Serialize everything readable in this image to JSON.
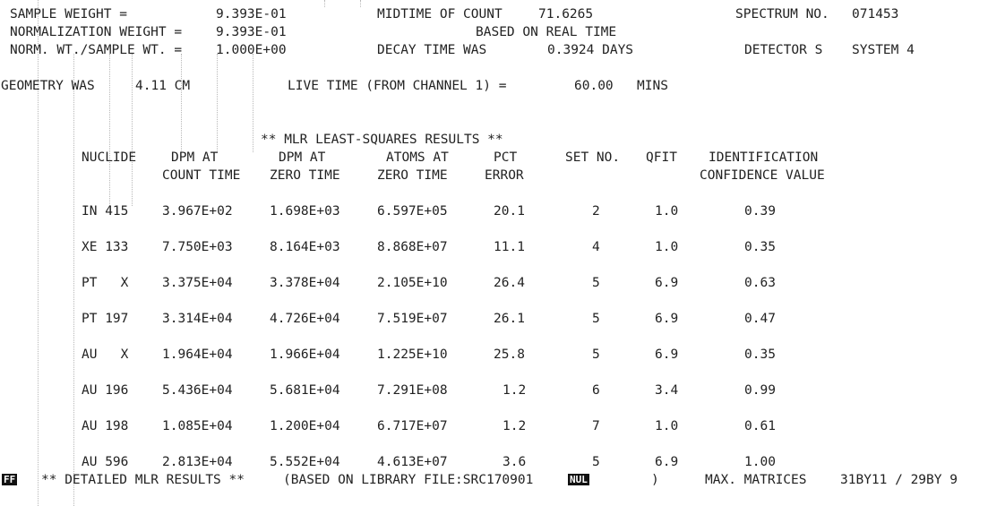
{
  "header": {
    "sample_weight_label": "SAMPLE WEIGHT =",
    "sample_weight_value": "9.393E-01",
    "norm_weight_label": "NORMALIZATION WEIGHT =",
    "norm_weight_value": "9.393E-01",
    "ratio_label": "NORM. WT./SAMPLE WT. =",
    "ratio_value": "1.000E+00",
    "midtime_label": "MIDTIME OF COUNT",
    "midtime_value": "71.6265",
    "based_on": "BASED ON REAL TIME",
    "decay_label": "DECAY TIME WAS",
    "decay_value": "0.3924 DAYS",
    "spectrum_label": "SPECTRUM NO.",
    "spectrum_value": "071453",
    "detector": "DETECTOR S",
    "system": "SYSTEM 4",
    "geometry_label": "GEOMETRY WAS",
    "geometry_value": "4.11 CM",
    "live_time_label": "LIVE TIME (FROM CHANNEL 1) =",
    "live_time_value": "60.00",
    "live_time_unit": "MINS"
  },
  "results": {
    "title": "** MLR LEAST-SQUARES RESULTS **",
    "headers": {
      "nuclide": "NUCLIDE",
      "dpm_count_1": "DPM AT",
      "dpm_count_2": "COUNT TIME",
      "dpm_zero_1": "DPM AT",
      "dpm_zero_2": "ZERO TIME",
      "atoms_1": "ATOMS AT",
      "atoms_2": "ZERO TIME",
      "pct_1": "PCT",
      "pct_2": "ERROR",
      "set_no": "SET NO.",
      "qfit": "QFIT",
      "ident_1": "IDENTIFICATION",
      "ident_2": "CONFIDENCE VALUE"
    },
    "rows": [
      {
        "nuclide": "IN 415",
        "dpm_count": "3.967E+02",
        "dpm_zero": "1.698E+03",
        "atoms": "6.597E+05",
        "pct": "20.1",
        "set": "2",
        "qfit": "1.0",
        "conf": "0.39"
      },
      {
        "nuclide": "XE 133",
        "dpm_count": "7.750E+03",
        "dpm_zero": "8.164E+03",
        "atoms": "8.868E+07",
        "pct": "11.1",
        "set": "4",
        "qfit": "1.0",
        "conf": "0.35"
      },
      {
        "nuclide": "PT   X",
        "dpm_count": "3.375E+04",
        "dpm_zero": "3.378E+04",
        "atoms": "2.105E+10",
        "pct": "26.4",
        "set": "5",
        "qfit": "6.9",
        "conf": "0.63"
      },
      {
        "nuclide": "PT 197",
        "dpm_count": "3.314E+04",
        "dpm_zero": "4.726E+04",
        "atoms": "7.519E+07",
        "pct": "26.1",
        "set": "5",
        "qfit": "6.9",
        "conf": "0.47"
      },
      {
        "nuclide": "AU   X",
        "dpm_count": "1.964E+04",
        "dpm_zero": "1.966E+04",
        "atoms": "1.225E+10",
        "pct": "25.8",
        "set": "5",
        "qfit": "6.9",
        "conf": "0.35"
      },
      {
        "nuclide": "AU 196",
        "dpm_count": "5.436E+04",
        "dpm_zero": "5.681E+04",
        "atoms": "7.291E+08",
        "pct": "1.2",
        "set": "6",
        "qfit": "3.4",
        "conf": "0.99"
      },
      {
        "nuclide": "AU 198",
        "dpm_count": "1.085E+04",
        "dpm_zero": "1.200E+04",
        "atoms": "6.717E+07",
        "pct": "1.2",
        "set": "7",
        "qfit": "1.0",
        "conf": "0.61"
      },
      {
        "nuclide": "AU 596",
        "dpm_count": "2.813E+04",
        "dpm_zero": "5.552E+04",
        "atoms": "4.613E+07",
        "pct": "3.6",
        "set": "5",
        "qfit": "6.9",
        "conf": "1.00"
      }
    ]
  },
  "footer": {
    "ff": "FF",
    "detailed": "** DETAILED MLR RESULTS **",
    "based_on_library": "(BASED ON LIBRARY FILE:SRC170901",
    "nul": "NUL",
    "close_paren": ")",
    "max_label": "MAX. MATRICES",
    "max_value": "31BY11 / 29BY 9"
  }
}
